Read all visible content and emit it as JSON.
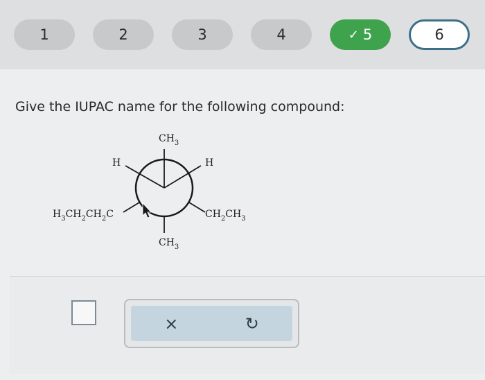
{
  "nav": {
    "steps": [
      {
        "label": "1",
        "state": "default"
      },
      {
        "label": "2",
        "state": "default"
      },
      {
        "label": "3",
        "state": "default"
      },
      {
        "label": "4",
        "state": "default"
      },
      {
        "label": "5",
        "state": "done",
        "check_icon": "check-icon"
      },
      {
        "label": "6",
        "state": "current"
      }
    ],
    "colors": {
      "done": "#3fa34d",
      "current_border": "#3c6f8a",
      "pill": "#c7c9cb"
    }
  },
  "question": {
    "prompt": "Give the IUPAC name for the following compound:"
  },
  "molecule": {
    "front_top": "CH",
    "front_top_sub": "3",
    "front_left": "H",
    "front_right": "H",
    "back_left_parts": [
      "H",
      "3",
      "CH",
      "2",
      "CH",
      "2",
      "C"
    ],
    "back_right_parts": [
      "CH",
      "2",
      "CH",
      "3"
    ],
    "back_bottom": "CH",
    "back_bottom_sub": "3"
  },
  "answer": {
    "clear_icon": "×",
    "undo_icon": "↻"
  }
}
